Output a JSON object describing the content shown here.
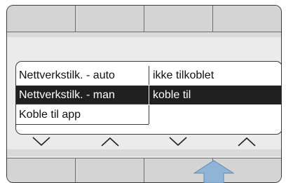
{
  "softkeys_top": [
    "",
    "",
    "",
    ""
  ],
  "softkeys_bottom": [
    "",
    "",
    "",
    ""
  ],
  "menu": {
    "rows": [
      {
        "label": "Nettverkstilk. - auto",
        "value": "ikke tilkoblet",
        "selected": false
      },
      {
        "label": "Nettverkstilk. - man",
        "value": "koble til",
        "selected": true
      },
      {
        "label": "Koble til app",
        "value": "",
        "selected": false
      }
    ]
  },
  "nav_arrows": [
    {
      "icon": "chevron-down-icon"
    },
    {
      "icon": "chevron-up-icon"
    },
    {
      "icon": "chevron-down-icon"
    },
    {
      "icon": "chevron-up-icon"
    }
  ],
  "pointer_arrow": {
    "icon": "arrow-up-icon",
    "color": "#8fb4d6"
  },
  "colors": {
    "selected_row": "#202020",
    "screen_bg": "#ebebeb",
    "softkey_bg": "#d4d4d4"
  }
}
